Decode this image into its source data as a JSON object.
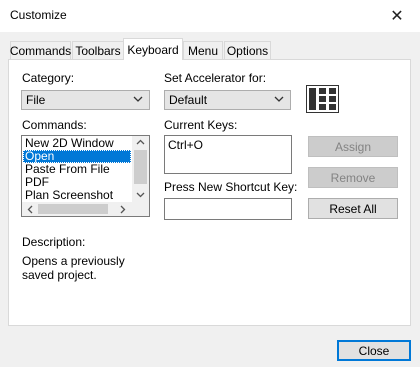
{
  "window": {
    "title": "Customize",
    "close_glyph": "✕"
  },
  "tabs": [
    {
      "label": "Commands",
      "active": false
    },
    {
      "label": "Toolbars",
      "active": false
    },
    {
      "label": "Keyboard",
      "active": true
    },
    {
      "label": "Menu",
      "active": false
    },
    {
      "label": "Options",
      "active": false
    }
  ],
  "category": {
    "label": "Category:",
    "value": "File"
  },
  "accelerator": {
    "label": "Set Accelerator for:",
    "value": "Default"
  },
  "commands": {
    "label": "Commands:",
    "items": [
      "New 2D Window",
      "Open",
      "Paste From File",
      "PDF",
      "Plan Screenshot"
    ],
    "selected_index": 1
  },
  "current_keys": {
    "label": "Current Keys:",
    "items": [
      "Ctrl+O"
    ]
  },
  "new_shortcut": {
    "label": "Press New Shortcut Key:",
    "value": ""
  },
  "buttons": {
    "assign": "Assign",
    "remove": "Remove",
    "reset_all": "Reset All",
    "close": "Close"
  },
  "description": {
    "label": "Description:",
    "text": "Opens a previously saved project."
  },
  "colors": {
    "selection": "#0078d7",
    "accent_border": "#0078d7"
  }
}
